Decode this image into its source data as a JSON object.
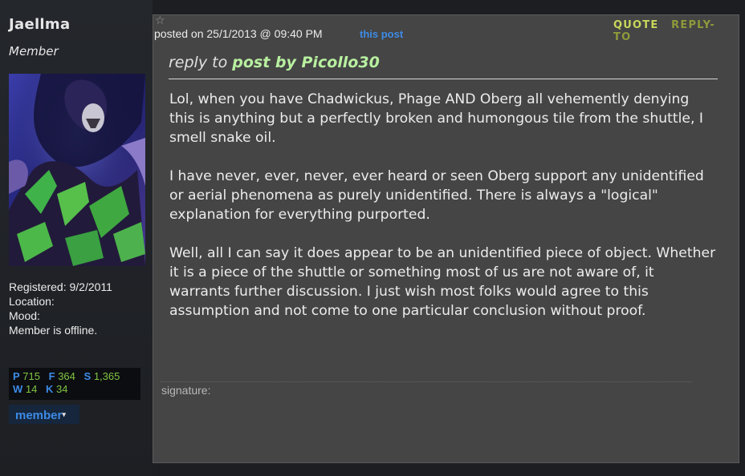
{
  "user": {
    "name": "Jaellma",
    "rank": "Member",
    "avatar_icon": "avatar-image",
    "registered": "Registered: 9/2/2011",
    "location": "Location:",
    "mood": "Mood:",
    "status": "Member is offline."
  },
  "stats": {
    "p_key": "P",
    "p_val": "715",
    "f_key": "F",
    "f_val": "364",
    "s_key": "S",
    "s_val": "1,365",
    "w_key": "W",
    "w_val": "14",
    "k_key": "K",
    "k_val": "34"
  },
  "member_button": {
    "label": "member",
    "caret": "▾"
  },
  "post": {
    "posted_on": "posted on 25/1/2013 @ 09:40 PM",
    "this_post": "this post",
    "quote_label": "QUOTE",
    "reply_label": "REPLY-TO",
    "reply_prefix": "reply to",
    "reply_link": "post by Picollo30",
    "paragraphs": [
      "Lol, when you have Chadwickus, Phage AND Oberg all vehemently denying this is anything but a perfectly broken and humongous tile from the shuttle, I smell snake oil.",
      "I have never, ever, never, ever heard or seen Oberg support any unidentified or aerial phenomena as purely unidentified. There is always a \"logical\" explanation for everything purported.",
      "Well, all I can say it does appear to be an unidentified piece of object. Whether it is a piece of the shuttle or something most of us are not aware of, it warrants further discussion. I just wish most folks would agree to this assumption and not come to one particular conclusion without proof."
    ],
    "signature_label": "signature:"
  },
  "colors": {
    "accent_blue": "#3d8be6",
    "stat_green": "#7fc443",
    "post_bg": "#454545",
    "reply_link_green": "#b8f0a0"
  }
}
